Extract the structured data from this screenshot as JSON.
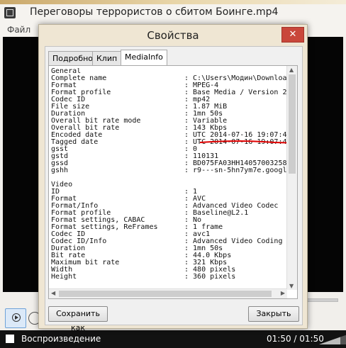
{
  "window": {
    "title": "Переговоры террористов о сбитом Боинге.mp4"
  },
  "menu": [
    "Файл"
  ],
  "dialog": {
    "title": "Свойства",
    "close_glyph": "✕",
    "tabs": [
      "Подробно",
      "Клип",
      "MediaInfo"
    ],
    "active_tab": "MediaInfo",
    "save_button": "Сохранить как",
    "close_button": "Закрыть",
    "info_rows": [
      {
        "k": "General",
        "v": ""
      },
      {
        "k": "Complete name",
        "v": ": C:\\Users\\Модин\\Downloa"
      },
      {
        "k": "Format",
        "v": ": MPEG-4"
      },
      {
        "k": "Format profile",
        "v": ": Base Media / Version 2"
      },
      {
        "k": "Codec ID",
        "v": ": mp42"
      },
      {
        "k": "File size",
        "v": ": 1.87 MiB"
      },
      {
        "k": "Duration",
        "v": ": 1mn 50s"
      },
      {
        "k": "Overall bit rate mode",
        "v": ": Variable"
      },
      {
        "k": "Overall bit rate",
        "v": ": 143 Kbps"
      },
      {
        "k": "Encoded date",
        "v": ": UTC 2014-07-16 19:07:4"
      },
      {
        "k": "Tagged date",
        "v": ": UTC 2014-07-16 19:07:4"
      },
      {
        "k": "gsst",
        "v": ": 0"
      },
      {
        "k": "gstd",
        "v": ": 110131"
      },
      {
        "k": "gssd",
        "v": ": BD075FA03HH14057003258"
      },
      {
        "k": "gshh",
        "v": ": r9---sn-5hn7ym7e.googl"
      },
      {
        "k": "",
        "v": ""
      },
      {
        "k": "Video",
        "v": ""
      },
      {
        "k": "ID",
        "v": ": 1"
      },
      {
        "k": "Format",
        "v": ": AVC"
      },
      {
        "k": "Format/Info",
        "v": ": Advanced Video Codec"
      },
      {
        "k": "Format profile",
        "v": ": Baseline@L2.1"
      },
      {
        "k": "Format settings, CABAC",
        "v": ": No"
      },
      {
        "k": "Format settings, ReFrames",
        "v": ": 1 frame"
      },
      {
        "k": "Codec ID",
        "v": ": avc1"
      },
      {
        "k": "Codec ID/Info",
        "v": ": Advanced Video Coding"
      },
      {
        "k": "Duration",
        "v": ": 1mn 50s"
      },
      {
        "k": "Bit rate",
        "v": ": 44.0 Kbps"
      },
      {
        "k": "Maximum bit rate",
        "v": ": 321 Kbps"
      },
      {
        "k": "Width",
        "v": ": 480 pixels"
      },
      {
        "k": "Height",
        "v": ": 360 pixels"
      }
    ]
  },
  "status": {
    "label": "Воспроизведение",
    "time": "01:50 / 01:50"
  },
  "colors": {
    "annotation": "#e00000",
    "close_button": "#c9473b"
  }
}
